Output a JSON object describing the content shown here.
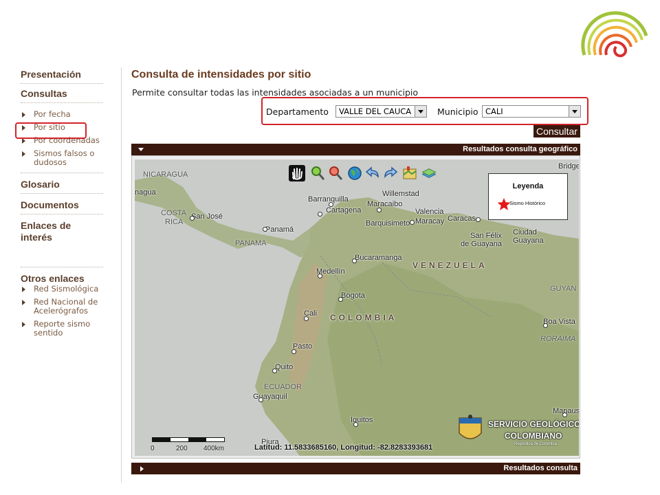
{
  "sidebar": {
    "presentacion": "Presentación",
    "consultas": "Consultas",
    "consultas_items": [
      "Por fecha",
      "Por sitio",
      "Por coordenadas",
      "Sismos falsos o",
      "dudosos"
    ],
    "glosario": "Glosario",
    "documentos": "Documentos",
    "enlaces_1": "Enlaces de",
    "enlaces_2": "interés",
    "otros": "Otros enlaces",
    "otros_items": {
      "red_sismo": "Red Sismológica",
      "red_acel_1": "Red Nacional de",
      "red_acel_2": "Acelerógrafos",
      "reporte_1": "Reporte sismo",
      "reporte_2": "sentido"
    }
  },
  "main": {
    "title": "Consulta de intensidades por sitio",
    "description": "Permite consultar todas las intensidades asociadas a un municipio",
    "departamento_label": "Departamento",
    "departamento_value": "VALLE DEL CAUCA",
    "municipio_label": "Municipio",
    "municipio_value": "CALI",
    "consultar_label": "Consultar",
    "panel_geo_label": "Resultados consulta geográfico",
    "panel_results_label": "Resultados consulta"
  },
  "map": {
    "legend_title": "Leyenda",
    "legend_item": "Sismo Histórico",
    "coords_text": "Latitud: 11.5833685160, Longitud: -82.8283393681",
    "scale_labels": [
      "0",
      "200",
      "400km"
    ],
    "watermark_line1": "SERVICIO GEOLÓGICO",
    "watermark_line2": "COLOMBIANO",
    "watermark_line3": "República de Colombia",
    "labels": {
      "nicaragua": "NICARAGUA",
      "nagua": "nagua",
      "costa1": "COSTA",
      "costa2": "RICA",
      "sanjose": "San José",
      "panama_city": "Panamá",
      "panama": "PANAMA",
      "barranquilla": "Barranquilla",
      "cartagena": "Cartagena",
      "maracaibo": "Maracaibo",
      "willemstad": "Willemstad",
      "valencia": "Valencia",
      "barquisimeto": "Barquisimeto",
      "maracay": "Maracay",
      "caracas": "Caracas",
      "bridge": "Bridge",
      "sanfelix1": "San Félix",
      "sanfelix2": "de Guayana",
      "ciudad1": "Ciudad",
      "ciudad2": "Guayana",
      "bucaramanga": "Bucaramanga",
      "venezuela": "VENEZUELA",
      "medellin": "Medellín",
      "bogota": "Bogota",
      "guyan": "GUYAN",
      "cali": "Cali",
      "colombia": "COLOMBIA",
      "boavista": "Boa Vista",
      "roraima": "RORAIMA",
      "pasto": "Pasto",
      "quito": "Quito",
      "ecuador": "ECUADOR",
      "guayaquil": "Guayaquil",
      "iquitos": "Iquitos",
      "manaus": "Manaus",
      "piura": "Piura"
    }
  },
  "colors": {
    "brand_dark": "#3a180d",
    "highlight_red": "#d2232a",
    "sidebar_heading": "#5a3e2b",
    "title_brown": "#6a3a1f"
  }
}
